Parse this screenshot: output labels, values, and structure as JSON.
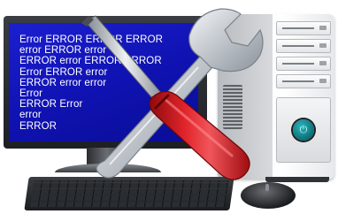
{
  "screen": {
    "error_lines": [
      "Error ERROR ERROR ERROR",
      "error ERROR error",
      "ERROR error ERROR ERROR",
      "Error ERROR error",
      "ERROR error error",
      "Error",
      "ERROR Error",
      "error",
      "ERROR"
    ]
  },
  "colors": {
    "screen_blue": "#1417c4",
    "screwdriver_handle": "#d6161b",
    "wrench_metal": "#c9cdd2",
    "power_button": "#1e9ea7"
  },
  "icons": {
    "power": "power-icon",
    "wrench": "wrench-icon",
    "screwdriver": "screwdriver-icon"
  }
}
